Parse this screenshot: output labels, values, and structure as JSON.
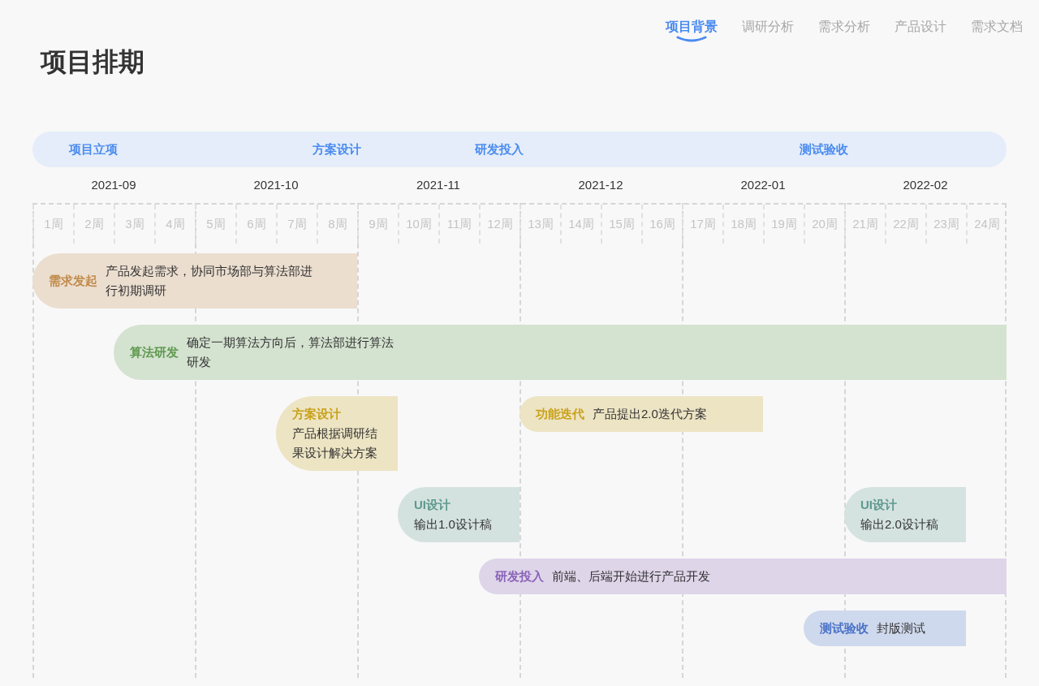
{
  "nav_tabs": [
    {
      "label": "项目背景",
      "selected": true
    },
    {
      "label": "调研分析",
      "selected": false
    },
    {
      "label": "需求分析",
      "selected": false
    },
    {
      "label": "产品设计",
      "selected": false
    },
    {
      "label": "需求文档",
      "selected": false
    }
  ],
  "title": "项目排期",
  "milestone_slots": [
    {
      "kind": "empty"
    },
    {
      "kind": "label",
      "label": "项目立项"
    },
    {
      "kind": "empty"
    },
    {
      "kind": "empty"
    },
    {
      "kind": "empty"
    },
    {
      "kind": "empty"
    },
    {
      "kind": "empty"
    },
    {
      "kind": "label",
      "label": "方案设计"
    },
    {
      "kind": "empty"
    },
    {
      "kind": "empty"
    },
    {
      "kind": "empty"
    },
    {
      "kind": "label",
      "label": "研发投入"
    },
    {
      "kind": "empty"
    },
    {
      "kind": "empty"
    },
    {
      "kind": "empty"
    },
    {
      "kind": "empty"
    },
    {
      "kind": "empty"
    },
    {
      "kind": "empty"
    },
    {
      "kind": "empty"
    },
    {
      "kind": "label",
      "label": "测试验收"
    }
  ],
  "months": [
    "2021-09",
    "2021-10",
    "2021-11",
    "2021-12",
    "2022-01",
    "2022-02"
  ],
  "weeks": [
    "1周",
    "2周",
    "3周",
    "4周",
    "5周",
    "6周",
    "7周",
    "8周",
    "9周",
    "10周",
    "11周",
    "12周",
    "13周",
    "14周",
    "15周",
    "16周",
    "17周",
    "18周",
    "19周",
    "20周",
    "21周",
    "22周",
    "23周",
    "24周"
  ],
  "rows": [
    {
      "slots": [
        {
          "kind": "inline-task",
          "title": "需求发起",
          "description": "产品发起需求，协同市场部与算法部进行初期调研",
          "color": "#c08a4a"
        },
        {
          "kind": "cont"
        },
        {
          "kind": "cont"
        },
        {
          "kind": "cont"
        },
        {
          "kind": "cont"
        },
        {
          "kind": "cont"
        },
        {
          "kind": "cont"
        },
        {
          "kind": "cont"
        }
      ]
    },
    {
      "slots": [
        {
          "kind": "empty"
        },
        {
          "kind": "empty"
        },
        {
          "kind": "inline-task",
          "title": "算法研发",
          "description": "确定一期算法方向后，算法部进行算法研发",
          "color": "#5f9a4f"
        },
        {
          "kind": "cont"
        },
        {
          "kind": "cont"
        },
        {
          "kind": "cont"
        },
        {
          "kind": "cont"
        },
        {
          "kind": "cont"
        },
        {
          "kind": "cont"
        },
        {
          "kind": "cont"
        },
        {
          "kind": "cont"
        },
        {
          "kind": "cont"
        },
        {
          "kind": "cont"
        },
        {
          "kind": "cont"
        },
        {
          "kind": "cont"
        },
        {
          "kind": "cont"
        },
        {
          "kind": "cont"
        },
        {
          "kind": "cont"
        },
        {
          "kind": "cont"
        },
        {
          "kind": "cont"
        },
        {
          "kind": "cont"
        },
        {
          "kind": "cont"
        },
        {
          "kind": "cont"
        },
        {
          "kind": "cont"
        }
      ]
    },
    {
      "slots": [
        {
          "kind": "empty"
        },
        {
          "kind": "empty"
        },
        {
          "kind": "empty"
        },
        {
          "kind": "empty"
        },
        {
          "kind": "empty"
        },
        {
          "kind": "empty"
        },
        {
          "kind": "stacked-task",
          "title": "方案设计",
          "description": "产品根据调研结果设计解决方案",
          "color": "#c9a21a"
        },
        {
          "kind": "cont"
        },
        {
          "kind": "cont"
        },
        {
          "kind": "empty"
        },
        {
          "kind": "empty"
        },
        {
          "kind": "empty"
        },
        {
          "kind": "inline-task",
          "title": "功能迭代",
          "description": "产品提出2.0迭代方案",
          "color": "#c9a21b"
        },
        {
          "kind": "cont"
        },
        {
          "kind": "cont"
        },
        {
          "kind": "cont"
        },
        {
          "kind": "cont"
        },
        {
          "kind": "cont"
        }
      ]
    },
    {
      "slots": [
        {
          "kind": "empty"
        },
        {
          "kind": "empty"
        },
        {
          "kind": "empty"
        },
        {
          "kind": "empty"
        },
        {
          "kind": "empty"
        },
        {
          "kind": "empty"
        },
        {
          "kind": "empty"
        },
        {
          "kind": "empty"
        },
        {
          "kind": "empty"
        },
        {
          "kind": "stacked-task",
          "title": "UI设计",
          "description": "输出1.0设计稿",
          "color": "#5f9a8e"
        },
        {
          "kind": "cont"
        },
        {
          "kind": "cont"
        },
        {
          "kind": "empty"
        },
        {
          "kind": "empty"
        },
        {
          "kind": "empty"
        },
        {
          "kind": "empty"
        },
        {
          "kind": "empty"
        },
        {
          "kind": "empty"
        },
        {
          "kind": "empty"
        },
        {
          "kind": "empty"
        },
        {
          "kind": "stacked-task",
          "title": "UI设计",
          "description": "输出2.0设计稿",
          "color": "#5f9a8f"
        },
        {
          "kind": "cont"
        },
        {
          "kind": "cont"
        }
      ]
    },
    {
      "slots": [
        {
          "kind": "empty"
        },
        {
          "kind": "empty"
        },
        {
          "kind": "empty"
        },
        {
          "kind": "empty"
        },
        {
          "kind": "empty"
        },
        {
          "kind": "empty"
        },
        {
          "kind": "empty"
        },
        {
          "kind": "empty"
        },
        {
          "kind": "empty"
        },
        {
          "kind": "empty"
        },
        {
          "kind": "empty"
        },
        {
          "kind": "inline-task",
          "title": "研发投入",
          "description": "前端、后端开始进行产品开发",
          "color": "#8a63b8"
        },
        {
          "kind": "cont"
        },
        {
          "kind": "cont"
        },
        {
          "kind": "cont"
        },
        {
          "kind": "cont"
        },
        {
          "kind": "cont"
        },
        {
          "kind": "cont"
        },
        {
          "kind": "cont"
        },
        {
          "kind": "cont"
        },
        {
          "kind": "cont"
        },
        {
          "kind": "cont"
        },
        {
          "kind": "cont"
        },
        {
          "kind": "cont"
        }
      ]
    },
    {
      "slots": [
        {
          "kind": "empty"
        },
        {
          "kind": "empty"
        },
        {
          "kind": "empty"
        },
        {
          "kind": "empty"
        },
        {
          "kind": "empty"
        },
        {
          "kind": "empty"
        },
        {
          "kind": "empty"
        },
        {
          "kind": "empty"
        },
        {
          "kind": "empty"
        },
        {
          "kind": "empty"
        },
        {
          "kind": "empty"
        },
        {
          "kind": "empty"
        },
        {
          "kind": "empty"
        },
        {
          "kind": "empty"
        },
        {
          "kind": "empty"
        },
        {
          "kind": "empty"
        },
        {
          "kind": "empty"
        },
        {
          "kind": "empty"
        },
        {
          "kind": "empty"
        },
        {
          "kind": "inline-task",
          "title": "测试验收",
          "description": "封版测试",
          "color": "#4a72c8"
        },
        {
          "kind": "cont"
        },
        {
          "kind": "cont"
        },
        {
          "kind": "cont"
        }
      ]
    }
  ]
}
